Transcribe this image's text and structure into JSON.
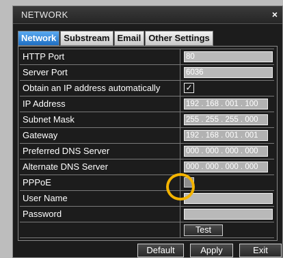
{
  "window": {
    "title": "NETWORK",
    "close_glyph": "×"
  },
  "tabs": [
    {
      "label": "Network",
      "active": true
    },
    {
      "label": "Substream",
      "active": false
    },
    {
      "label": "Email",
      "active": false
    },
    {
      "label": "Other Settings",
      "active": false
    }
  ],
  "fields": {
    "http_port": {
      "label": "HTTP Port",
      "value": "80"
    },
    "server_port": {
      "label": "Server Port",
      "value": "6036"
    },
    "obtain_ip": {
      "label": "Obtain an IP address automatically",
      "checked": true
    },
    "ip_address": {
      "label": "IP Address",
      "value": "192 . 168 . 001 . 100"
    },
    "subnet_mask": {
      "label": "Subnet Mask",
      "value": "255 . 255 . 255 . 000"
    },
    "gateway": {
      "label": "Gateway",
      "value": "192 . 168 . 001 . 001"
    },
    "preferred_dns": {
      "label": "Preferred DNS Server",
      "value": "000 . 000 . 000 . 000"
    },
    "alternate_dns": {
      "label": "Alternate DNS Server",
      "value": "000 . 000 . 000 . 000"
    },
    "pppoe": {
      "label": "PPPoE",
      "checked": false
    },
    "user_name": {
      "label": "User Name",
      "value": ""
    },
    "password": {
      "label": "Password",
      "value": ""
    }
  },
  "test_button": "Test",
  "footer": {
    "default": "Default",
    "apply": "Apply",
    "exit": "Exit"
  },
  "colors": {
    "highlight": "#f4b400",
    "active_tab": "#2f86d8"
  }
}
